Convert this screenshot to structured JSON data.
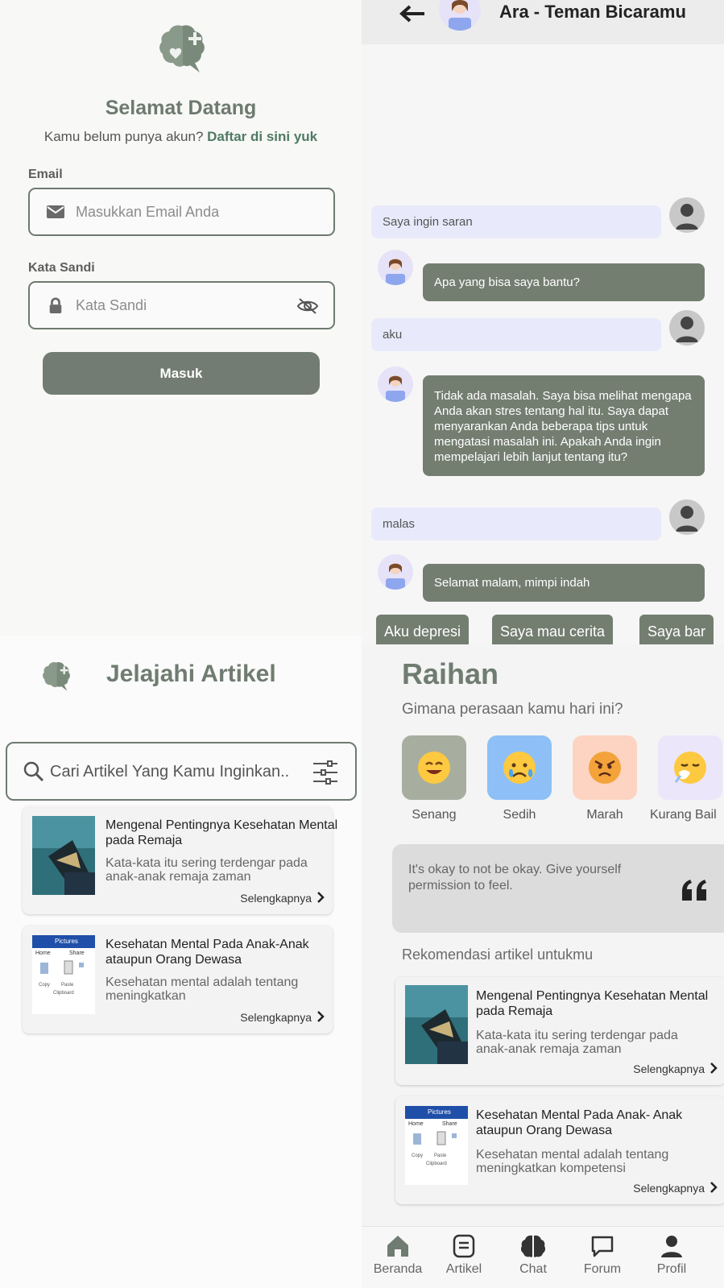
{
  "login": {
    "title": "Selamat Datang",
    "subtitle_text": "Kamu belum punya akun?",
    "register_link": "Daftar di sini yuk",
    "email_label": "Email",
    "email_placeholder": "Masukkan Email Anda",
    "password_label": "Kata Sandi",
    "password_placeholder": "Kata Sandi",
    "login_button": "Masuk"
  },
  "chat": {
    "title": "Ara - Teman Bicaramu",
    "messages": [
      {
        "from": "user",
        "text": "Saya ingin saran"
      },
      {
        "from": "bot",
        "text": "Apa yang bisa saya bantu?"
      },
      {
        "from": "user",
        "text": "aku"
      },
      {
        "from": "bot",
        "text": "Tidak ada masalah. Saya bisa melihat mengapa Anda akan stres tentang hal itu. Saya dapat menyarankan Anda beberapa tips untuk mengatasi masalah ini. Apakah Anda ingin mempelajari lebih lanjut tentang itu?"
      },
      {
        "from": "user",
        "text": "malas"
      },
      {
        "from": "bot",
        "text": "Selamat malam, mimpi indah"
      }
    ],
    "quick_replies": [
      "Aku depresi",
      "Saya mau cerita",
      "Saya bar"
    ]
  },
  "articles_page": {
    "title": "Jelajahi Artikel",
    "search_placeholder": "Cari Artikel Yang Kamu Inginkan..",
    "items": [
      {
        "title": "Mengenal Pentingnya Kesehatan Mental pada Remaja",
        "excerpt": "Kata-kata itu sering terdengar pada anak-anak remaja zaman",
        "more": "Selengkapnya"
      },
      {
        "title": "Kesehatan Mental Pada Anak-Anak ataupun Orang Dewasa",
        "excerpt": "Kesehatan mental adalah tentang meningkatkan",
        "more": "Selengkapnya"
      }
    ],
    "thumb2_texts": {
      "folder": "Pictures",
      "home": "Home",
      "share": "Share",
      "copy": "Copy",
      "paste": "Paste",
      "clipboard": "Clipboard"
    }
  },
  "home": {
    "user_name": "Raihan",
    "question": "Gimana perasaan kamu hari ini?",
    "moods": [
      {
        "label": "Senang",
        "emoji": "😊",
        "color": "#a7ae9f"
      },
      {
        "label": "Sedih",
        "emoji": "😢",
        "color": "#8ec0f7"
      },
      {
        "label": "Marah",
        "emoji": "😠",
        "color": "#fcd4c1"
      },
      {
        "label": "Kurang Bail",
        "emoji": "🤧",
        "color": "#ece6fa"
      }
    ],
    "quote": "It's okay to not be okay. Give yourself permission to feel.",
    "recommend_title": "Rekomendasi artikel untukmu",
    "items": [
      {
        "title": "Mengenal Pentingnya Kesehatan Mental pada Remaja",
        "excerpt": "Kata-kata itu sering terdengar pada anak-anak remaja zaman",
        "more": "Selengkapnya"
      },
      {
        "title": "Kesehatan Mental Pada Anak- Anak ataupun Orang Dewasa",
        "excerpt": "Kesehatan mental adalah tentang meningkatkan kompetensi",
        "more": "Selengkapnya"
      }
    ],
    "nav": [
      "Beranda",
      "Artikel",
      "Chat",
      "Forum",
      "Profil"
    ]
  },
  "colors": {
    "brand": "#727c72",
    "link": "#4f7a63",
    "user_bubble": "#e8eafb",
    "bot_bubble": "#737e71"
  },
  "icons": [
    "brain-logo-icon",
    "mail-icon",
    "lock-icon",
    "eye-off-icon",
    "arrow-left-icon",
    "search-icon",
    "filter-icon",
    "chevron-right-icon",
    "quote-icon",
    "home-icon",
    "article-icon",
    "brain-icon",
    "forum-icon",
    "profile-icon"
  ]
}
